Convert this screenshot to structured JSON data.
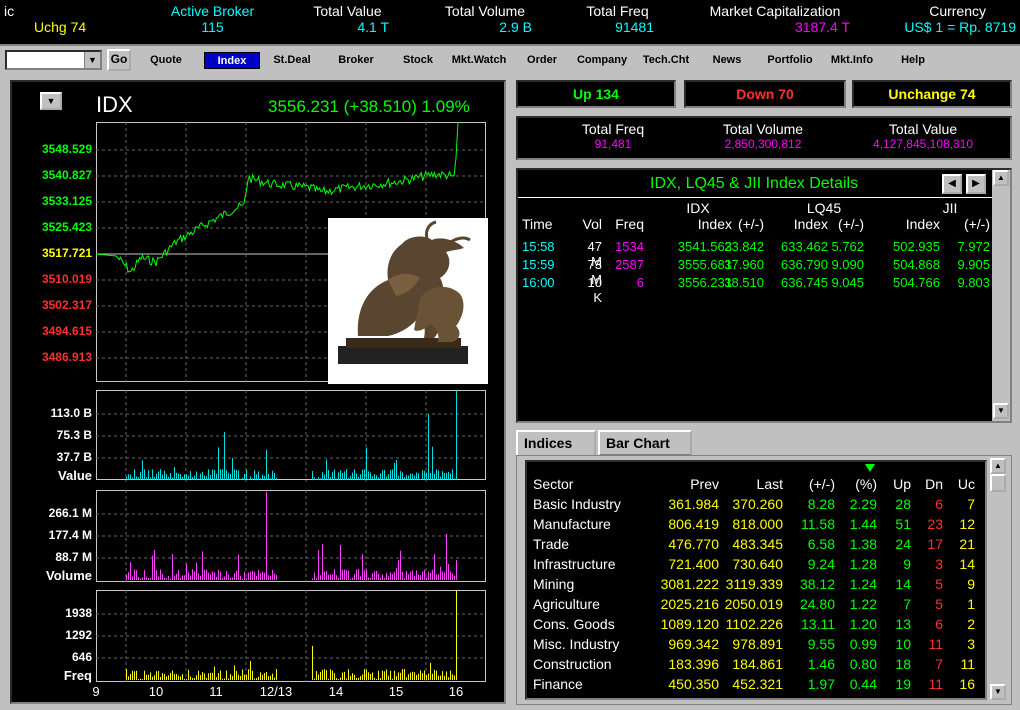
{
  "ticker": {
    "items": [
      {
        "head": "ic",
        "value": "Uchg 74",
        "head_color": "#ffffff",
        "value_color": "#ffff00"
      },
      {
        "head": "Active Broker",
        "value": "115",
        "head_color": "#00ffff",
        "value_color": "#00ffff"
      },
      {
        "head": "Total Value",
        "value": "4.1 T",
        "head_color": "#ffffff",
        "value_color": "#00ffff"
      },
      {
        "head": "Total Volume",
        "value": "2.9 B",
        "head_color": "#ffffff",
        "value_color": "#00ffff"
      },
      {
        "head": "Total Freq",
        "value": "91481",
        "head_color": "#ffffff",
        "value_color": "#00ffff"
      },
      {
        "head": "Market Capitalization",
        "value": "3187.4 T",
        "head_color": "#ffffff",
        "value_color": "#ff00ff"
      },
      {
        "head": "Currency",
        "value": "US$ 1 = Rp. 8719",
        "head_color": "#ffffff",
        "value_color": "#00ffff"
      }
    ]
  },
  "toolbar": {
    "go_label": "Go",
    "buttons": [
      "Quote",
      "Index",
      "St.Deal",
      "Broker",
      "Stock",
      "Mkt.Watch",
      "Order",
      "Company",
      "Tech.Cht",
      "News",
      "Portfolio",
      "Mkt.Info",
      "Help"
    ],
    "active": "Index"
  },
  "index_panel": {
    "name": "IDX",
    "quote": "3556.231 (+38.510)  1.09%",
    "price_ticks": [
      "3548.529",
      "3540.827",
      "3533.125",
      "3525.423",
      "3517.721",
      "3510.019",
      "3502.317",
      "3494.615",
      "3486.913"
    ],
    "value_ticks": [
      "113.0 B",
      "75.3 B",
      "37.7 B"
    ],
    "value_label": "Value",
    "volume_ticks": [
      "266.1 M",
      "177.4 M",
      "88.7 M"
    ],
    "volume_label": "Volume",
    "freq_ticks": [
      "1938",
      "1292",
      "646"
    ],
    "freq_label": "Freq",
    "x_ticks": [
      "9",
      "10",
      "11",
      "12/13",
      "14",
      "15",
      "16"
    ]
  },
  "badges": {
    "up": "Up 134",
    "down": "Down  70",
    "unchange": "Unchange  74"
  },
  "totals": [
    {
      "label": "Total Freq",
      "value": "91,481"
    },
    {
      "label": "Total Volume",
      "value": "2,850,300,812"
    },
    {
      "label": "Total Value",
      "value": "4,127,845,108,310"
    }
  ],
  "details": {
    "title": "IDX, LQ45 & JII Index Details",
    "group_heads": [
      "IDX",
      "LQ45",
      "JII"
    ],
    "col_heads": [
      "Time",
      "Vol",
      "Freq",
      "Index",
      "(+/-)",
      "Index",
      "(+/-)",
      "Index",
      "(+/-)"
    ],
    "rows": [
      [
        "15:58",
        "47 M",
        "1534",
        "3541.563",
        "23.842",
        "633.462",
        "5.762",
        "502.935",
        "7.972"
      ],
      [
        "15:59",
        "73 M",
        "2587",
        "3555.681",
        "37.960",
        "636.790",
        "9.090",
        "504.868",
        "9.905"
      ],
      [
        "16:00",
        "10 K",
        "6",
        "3556.231",
        "38.510",
        "636.745",
        "9.045",
        "504.766",
        "9.803"
      ]
    ]
  },
  "tabs": [
    "Indices",
    "Bar Chart"
  ],
  "sectors": {
    "heads": [
      "Sector",
      "Prev",
      "Last",
      "(+/-)",
      "(%)",
      "Up",
      "Dn",
      "Uc"
    ],
    "rows": [
      [
        "Basic Industry",
        "361.984",
        "370.260",
        "8.28",
        "2.29",
        "28",
        "6",
        "7"
      ],
      [
        "Manufacture",
        "806.419",
        "818.000",
        "11.58",
        "1.44",
        "51",
        "23",
        "12"
      ],
      [
        "Trade",
        "476.770",
        "483.345",
        "6.58",
        "1.38",
        "24",
        "17",
        "21"
      ],
      [
        "Infrastructure",
        "721.400",
        "730.640",
        "9.24",
        "1.28",
        "9",
        "3",
        "14"
      ],
      [
        "Mining",
        "3081.222",
        "3119.339",
        "38.12",
        "1.24",
        "14",
        "5",
        "9"
      ],
      [
        "Agriculture",
        "2025.216",
        "2050.019",
        "24.80",
        "1.22",
        "7",
        "5",
        "1"
      ],
      [
        "Cons. Goods",
        "1089.120",
        "1102.226",
        "13.11",
        "1.20",
        "13",
        "6",
        "2"
      ],
      [
        "Misc. Industry",
        "969.342",
        "978.891",
        "9.55",
        "0.99",
        "10",
        "11",
        "3"
      ],
      [
        "Construction",
        "183.396",
        "184.861",
        "1.46",
        "0.80",
        "18",
        "7",
        "11"
      ],
      [
        "Finance",
        "450.350",
        "452.321",
        "1.97",
        "0.44",
        "19",
        "11",
        "16"
      ]
    ]
  },
  "colors": {
    "up": "#00ff00",
    "down": "#ff3030",
    "neutral": "#ffff00",
    "value_bars": "#00e0e0",
    "volume_bars": "#ff40ff",
    "freq_bars": "#ffff00"
  }
}
